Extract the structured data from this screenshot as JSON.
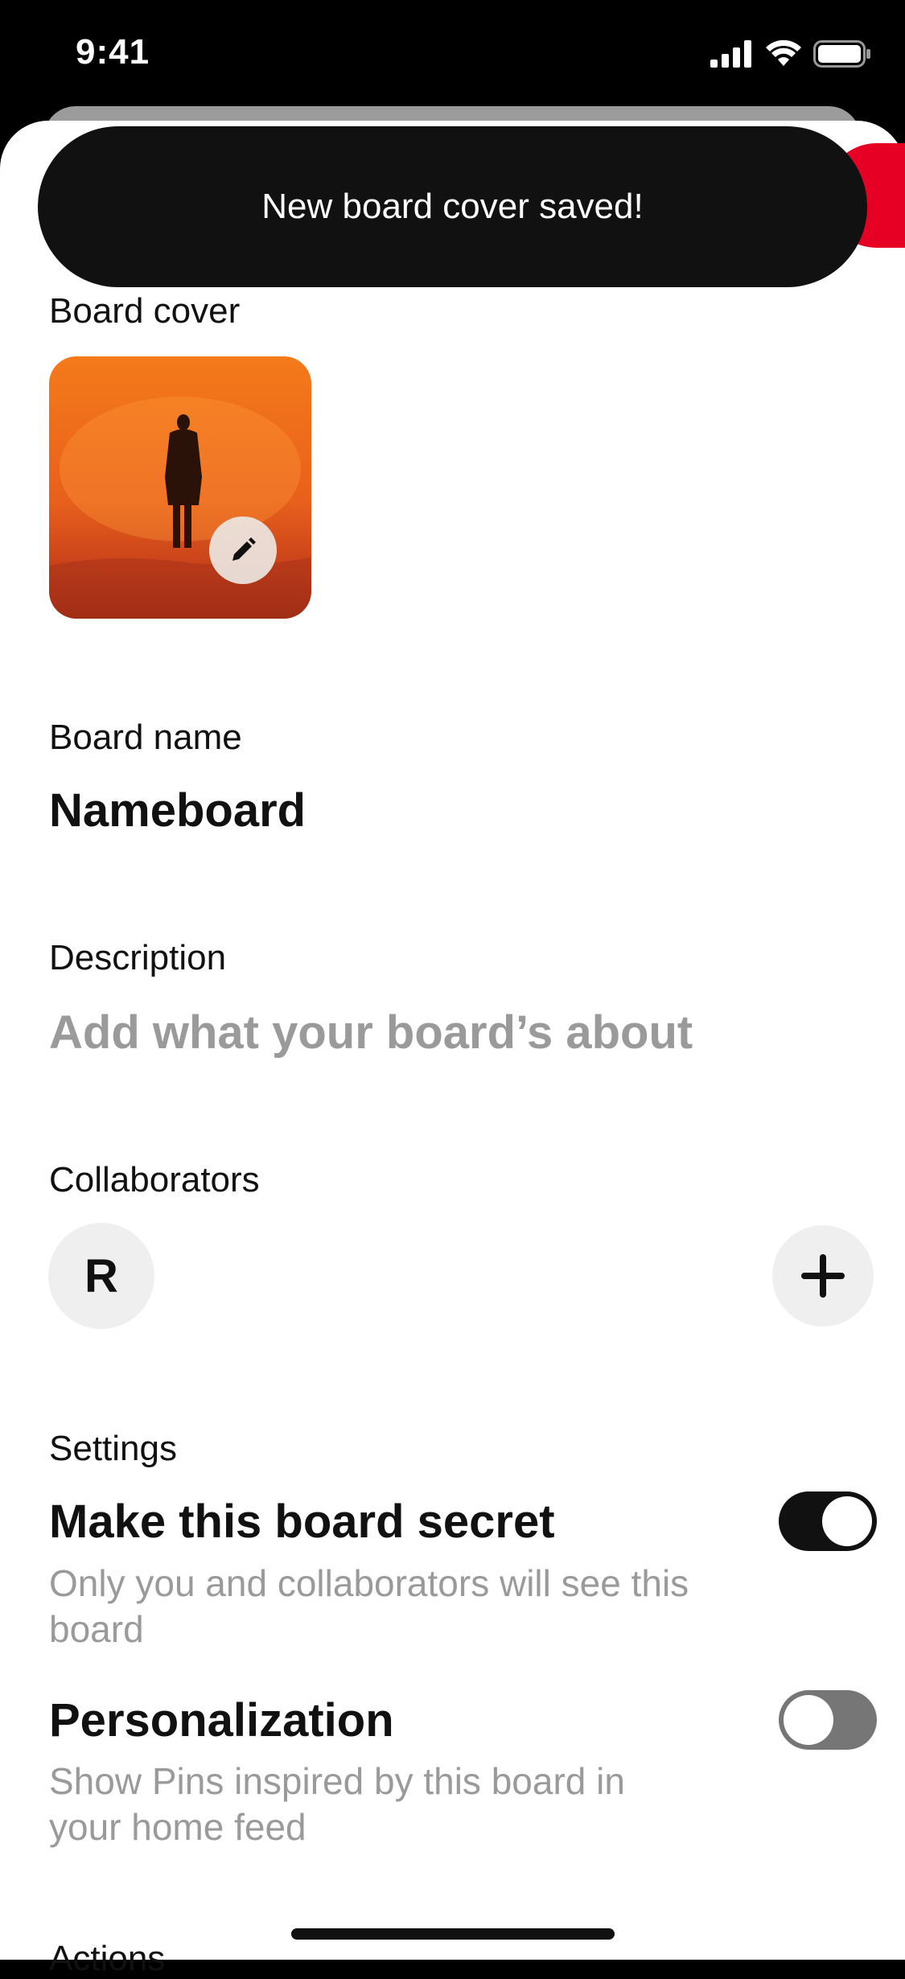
{
  "status_bar": {
    "time": "9:41"
  },
  "toast": {
    "message": "New board cover saved!"
  },
  "board_cover": {
    "label": "Board cover"
  },
  "board_name": {
    "label": "Board name",
    "value": "Nameboard"
  },
  "description": {
    "label": "Description",
    "placeholder": "Add what your board’s about"
  },
  "collaborators": {
    "label": "Collaborators",
    "items": [
      {
        "initial": "R"
      }
    ]
  },
  "settings": {
    "label": "Settings",
    "items": [
      {
        "title": "Make this board secret",
        "description": "Only you and collaborators will see this board",
        "enabled": true
      },
      {
        "title": "Personalization",
        "description": "Show Pins inspired by this board in your home feed",
        "enabled": false
      }
    ]
  },
  "next_section": {
    "label": "Actions"
  },
  "colors": {
    "accent": "#e60023",
    "toast_bg": "#111111",
    "toggle_on": "#111111",
    "toggle_off": "#767676"
  }
}
